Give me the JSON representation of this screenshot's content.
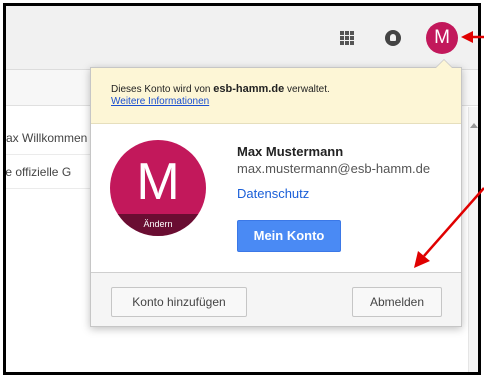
{
  "header": {
    "apps_icon": "apps-grid-icon",
    "notifications_icon": "notifications-bell-icon",
    "avatar_letter": "M"
  },
  "background_list": {
    "rows": [
      "Max Willkommen",
      "die offizielle G"
    ]
  },
  "account_panel": {
    "notice": {
      "prefix": "Dieses Konto wird von ",
      "domain": "esb-hamm.de",
      "suffix": " verwaltet.",
      "link": "Weitere Informationen"
    },
    "avatar": {
      "letter": "M",
      "change_label": "Ändern"
    },
    "name": "Max Mustermann",
    "email": "max.mustermann@esb-hamm.de",
    "privacy_link": "Datenschutz",
    "my_account_button": "Mein Konto",
    "add_account_button": "Konto hinzufügen",
    "sign_out_button": "Abmelden"
  },
  "colors": {
    "avatar": "#c2185b",
    "primary_button": "#4a8af4",
    "notice_bg": "#fdf6d6",
    "annotation_arrow": "#e00000"
  }
}
